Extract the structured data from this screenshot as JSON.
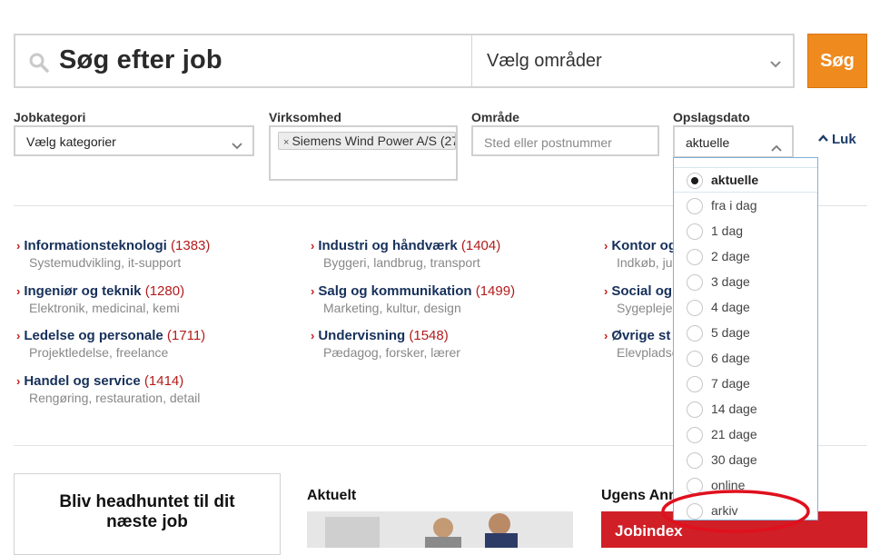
{
  "search": {
    "query": "Søg efter job",
    "area_label": "Vælg områder",
    "button_label": "Søg"
  },
  "filters": {
    "jobkategori": {
      "label": "Jobkategori",
      "value": "Vælg kategorier"
    },
    "virksomhed": {
      "label": "Virksomhed",
      "tag": "Siemens Wind Power A/S (27"
    },
    "omrade": {
      "label": "Område",
      "placeholder": "Sted eller postnummer"
    },
    "opslagsdato": {
      "label": "Opslagsdato",
      "value": "aktuelle"
    },
    "close_label": "Luk"
  },
  "categories": [
    {
      "title": "Informationsteknologi",
      "count": "(1383)",
      "sub": "Systemudvikling, it-support"
    },
    {
      "title": "Industri og håndværk",
      "count": "(1404)",
      "sub": "Byggeri, landbrug, transport"
    },
    {
      "title": "Kontor og",
      "count": "",
      "sub": "Indkøb, jur"
    },
    {
      "title": "Ingeniør og teknik",
      "count": "(1280)",
      "sub": "Elektronik, medicinal, kemi"
    },
    {
      "title": "Salg og kommunikation",
      "count": "(1499)",
      "sub": "Marketing, kultur, design"
    },
    {
      "title": "Social og",
      "count": "",
      "sub": "Sygeplejer"
    },
    {
      "title": "Ledelse og personale",
      "count": "(1711)",
      "sub": "Projektledelse, freelance"
    },
    {
      "title": "Undervisning",
      "count": "(1548)",
      "sub": "Pædagog, forsker, lærer"
    },
    {
      "title": "Øvrige st",
      "count": "",
      "sub": "Elevpladse"
    },
    {
      "title": "Handel og service",
      "count": "(1414)",
      "sub": "Rengøring, restauration, detail"
    }
  ],
  "bottom": {
    "headhunt_text": "Bliv headhuntet til dit næste job",
    "aktuelt_title": "Aktuelt",
    "ugens_title": "Ugens Ann",
    "banner_text": "Jobindex"
  },
  "date_options": [
    {
      "label": "aktuelle",
      "selected": true
    },
    {
      "label": "fra i dag",
      "selected": false
    },
    {
      "label": "1 dag",
      "selected": false
    },
    {
      "label": "2 dage",
      "selected": false
    },
    {
      "label": "3 dage",
      "selected": false
    },
    {
      "label": "4 dage",
      "selected": false
    },
    {
      "label": "5 dage",
      "selected": false
    },
    {
      "label": "6 dage",
      "selected": false
    },
    {
      "label": "7 dage",
      "selected": false
    },
    {
      "label": "14 dage",
      "selected": false
    },
    {
      "label": "21 dage",
      "selected": false
    },
    {
      "label": "30 dage",
      "selected": false
    },
    {
      "label": "online",
      "selected": false
    },
    {
      "label": "arkiv",
      "selected": false
    }
  ],
  "colors": {
    "accent_orange": "#ef8a1e",
    "link_navy": "#16305a",
    "count_red": "#b31b1b",
    "highlight_red": "#e0101e"
  }
}
